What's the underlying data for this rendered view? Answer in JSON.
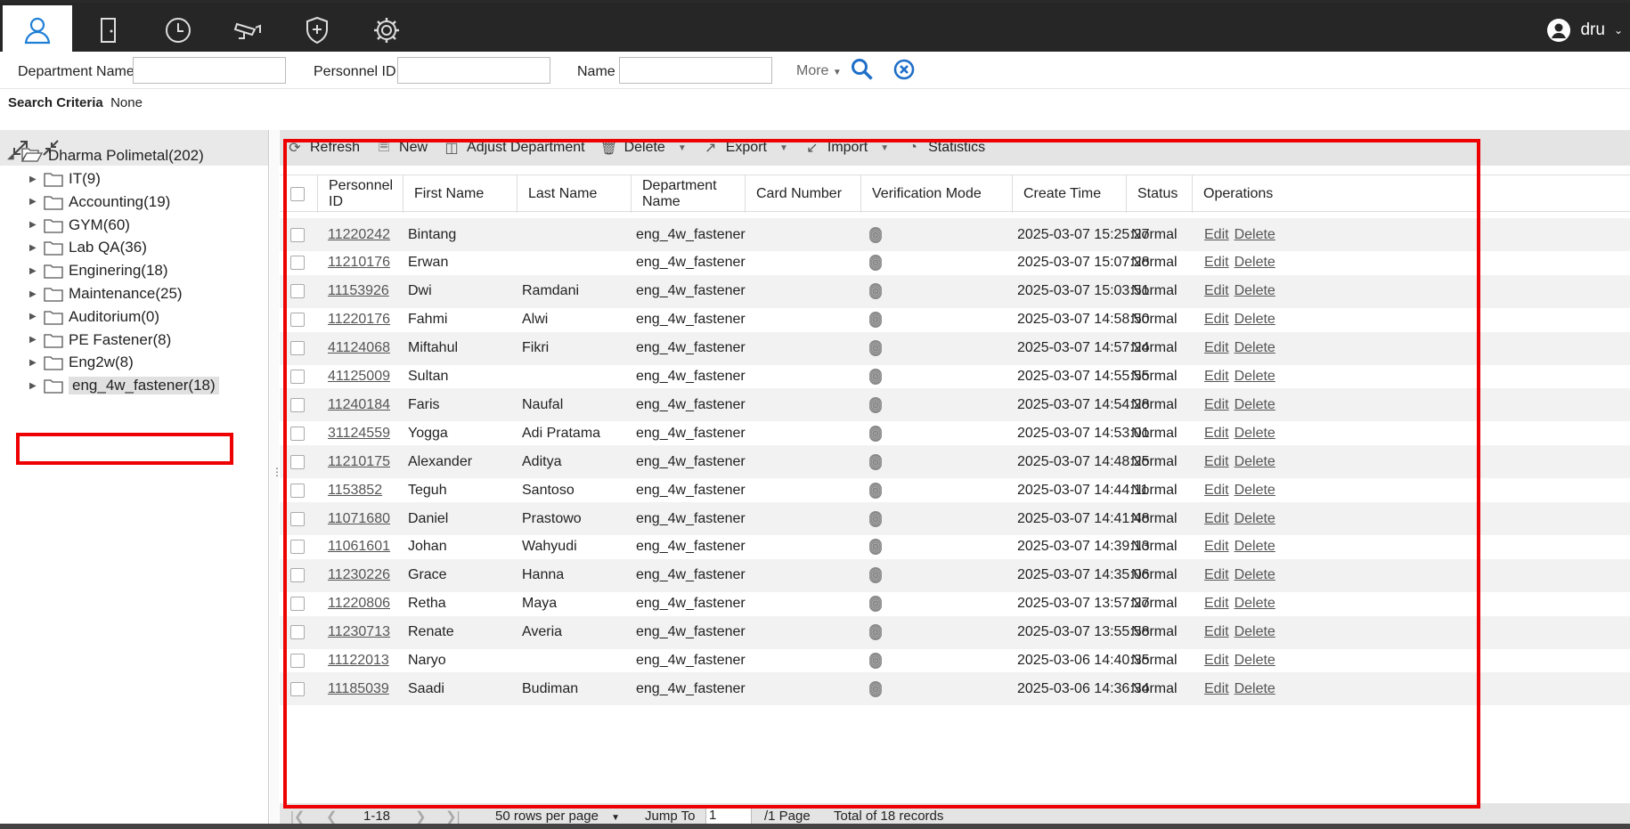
{
  "nav": {
    "icons": [
      "person-icon",
      "door-icon",
      "clock-icon",
      "cctv-icon",
      "shield-plus-icon",
      "gear-icon"
    ],
    "user": "dru"
  },
  "search": {
    "dept_label": "Department Name",
    "pid_label": "Personnel ID",
    "name_label": "Name",
    "more": "More",
    "criteria_label": "Search Criteria",
    "criteria_value": "None"
  },
  "tree": {
    "root": "Dharma Polimetal(202)",
    "items": [
      "IT(9)",
      "Accounting(19)",
      "GYM(60)",
      "Lab QA(36)",
      "Enginering(18)",
      "Maintenance(25)",
      "Auditorium(0)",
      "PE Fastener(8)",
      "Eng2w(8)",
      "eng_4w_fastener(18)"
    ]
  },
  "toolbar": {
    "refresh": "Refresh",
    "new": "New",
    "adjust": "Adjust Department",
    "delete": "Delete",
    "export": "Export",
    "import": "Import",
    "statistics": "Statistics"
  },
  "columns": [
    "Personnel ID",
    "First Name",
    "Last Name",
    "Department Name",
    "Card Number",
    "Verification Mode",
    "Create Time",
    "Status",
    "Operations"
  ],
  "ops": {
    "edit": "Edit",
    "delete": "Delete"
  },
  "rows": [
    [
      "11220242",
      "Bintang",
      "",
      "eng_4w_fastener",
      "",
      "2025-03-07 15:25:27",
      "Normal"
    ],
    [
      "11210176",
      "Erwan",
      "",
      "eng_4w_fastener",
      "",
      "2025-03-07 15:07:28",
      "Normal"
    ],
    [
      "11153926",
      "Dwi",
      "Ramdani",
      "eng_4w_fastener",
      "",
      "2025-03-07 15:03:51",
      "Normal"
    ],
    [
      "11220176",
      "Fahmi",
      "Alwi",
      "eng_4w_fastener",
      "",
      "2025-03-07 14:58:50",
      "Normal"
    ],
    [
      "41124068",
      "Miftahul",
      "Fikri",
      "eng_4w_fastener",
      "",
      "2025-03-07 14:57:24",
      "Normal"
    ],
    [
      "41125009",
      "Sultan",
      "",
      "eng_4w_fastener",
      "",
      "2025-03-07 14:55:55",
      "Normal"
    ],
    [
      "11240184",
      "Faris",
      "Naufal",
      "eng_4w_fastener",
      "",
      "2025-03-07 14:54:28",
      "Normal"
    ],
    [
      "31124559",
      "Yogga",
      "Adi Pratama",
      "eng_4w_fastener",
      "",
      "2025-03-07 14:53:01",
      "Normal"
    ],
    [
      "11210175",
      "Alexander",
      "Aditya",
      "eng_4w_fastener",
      "",
      "2025-03-07 14:48:25",
      "Normal"
    ],
    [
      "1153852",
      "Teguh",
      "Santoso",
      "eng_4w_fastener",
      "",
      "2025-03-07 14:44:11",
      "Normal"
    ],
    [
      "11071680",
      "Daniel",
      "Prastowo",
      "eng_4w_fastener",
      "",
      "2025-03-07 14:41:48",
      "Normal"
    ],
    [
      "11061601",
      "Johan",
      "Wahyudi",
      "eng_4w_fastener",
      "",
      "2025-03-07 14:39:13",
      "Normal"
    ],
    [
      "11230226",
      "Grace",
      "Hanna",
      "eng_4w_fastener",
      "",
      "2025-03-07 14:35:06",
      "Normal"
    ],
    [
      "11220806",
      "Retha",
      "Maya",
      "eng_4w_fastener",
      "",
      "2025-03-07 13:57:27",
      "Normal"
    ],
    [
      "11230713",
      "Renate",
      "Averia",
      "eng_4w_fastener",
      "",
      "2025-03-07 13:55:58",
      "Normal"
    ],
    [
      "11122013",
      "Naryo",
      "",
      "eng_4w_fastener",
      "",
      "2025-03-06 14:40:35",
      "Normal"
    ],
    [
      "11185039",
      "Saadi",
      "Budiman",
      "eng_4w_fastener",
      "",
      "2025-03-06 14:36:34",
      "Normal"
    ]
  ],
  "pager": {
    "range": "1-18",
    "per_page": "50 rows per page",
    "jump": "Jump To",
    "page_value": "1",
    "pages": "/1 Page",
    "total": "Total of 18 records"
  }
}
